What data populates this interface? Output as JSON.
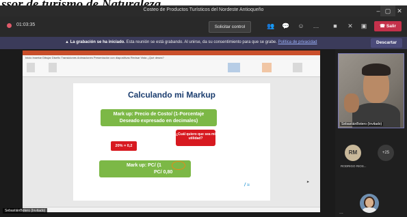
{
  "header_fragment": "ssor de turismo de Naturaleza",
  "window": {
    "title": "Costeo de Productos Turísticos del Nordeste Antioqueño",
    "minimize": "–",
    "maximize": "▢",
    "close": "✕"
  },
  "toolbar": {
    "timer": "01:03:35",
    "request_control": "Solicitar control",
    "leave": "Salir"
  },
  "banner": {
    "bold": "La grabación se ha iniciado.",
    "text": " Esta reunión se está grabando. Al unirse, da su consentimiento para que se grabe. ",
    "link": "Política de privacidad",
    "dismiss": "Descartar"
  },
  "ppt": {
    "menu": "Inicio   Insertar   Dibujar   Diseño   Transiciones   Animaciones   Presentación con diapositivas   Revisar   Vista   ¿Qué desea?"
  },
  "slide": {
    "title": "Calculando mi Markup",
    "formula_line1": "Mark up:  Precio de Costo/ (1-Porcentaje",
    "formula_line2": "Deseado expresado en decimales)",
    "callout": "¿Cuál quiero que sea mi utilidad?",
    "percent": "20% = 0,2",
    "calc_line1": "Mark up:  PC/ (1",
    "calc_line2": "PC/ 0,80"
  },
  "presenter_tag": "SebastiánBotero (Invitado)",
  "participants": {
    "main_video_name": "SebastiánBotero (Invitado)",
    "rm_initials": "RM",
    "rm_name": "RODRIGO RIOS...",
    "more": "+25",
    "ellipsis": "..."
  },
  "colors": {
    "slide_green": "#7cb846",
    "slide_red": "#d71920",
    "leave_red": "#c4314b",
    "banner_bg": "#3b3b5a"
  }
}
